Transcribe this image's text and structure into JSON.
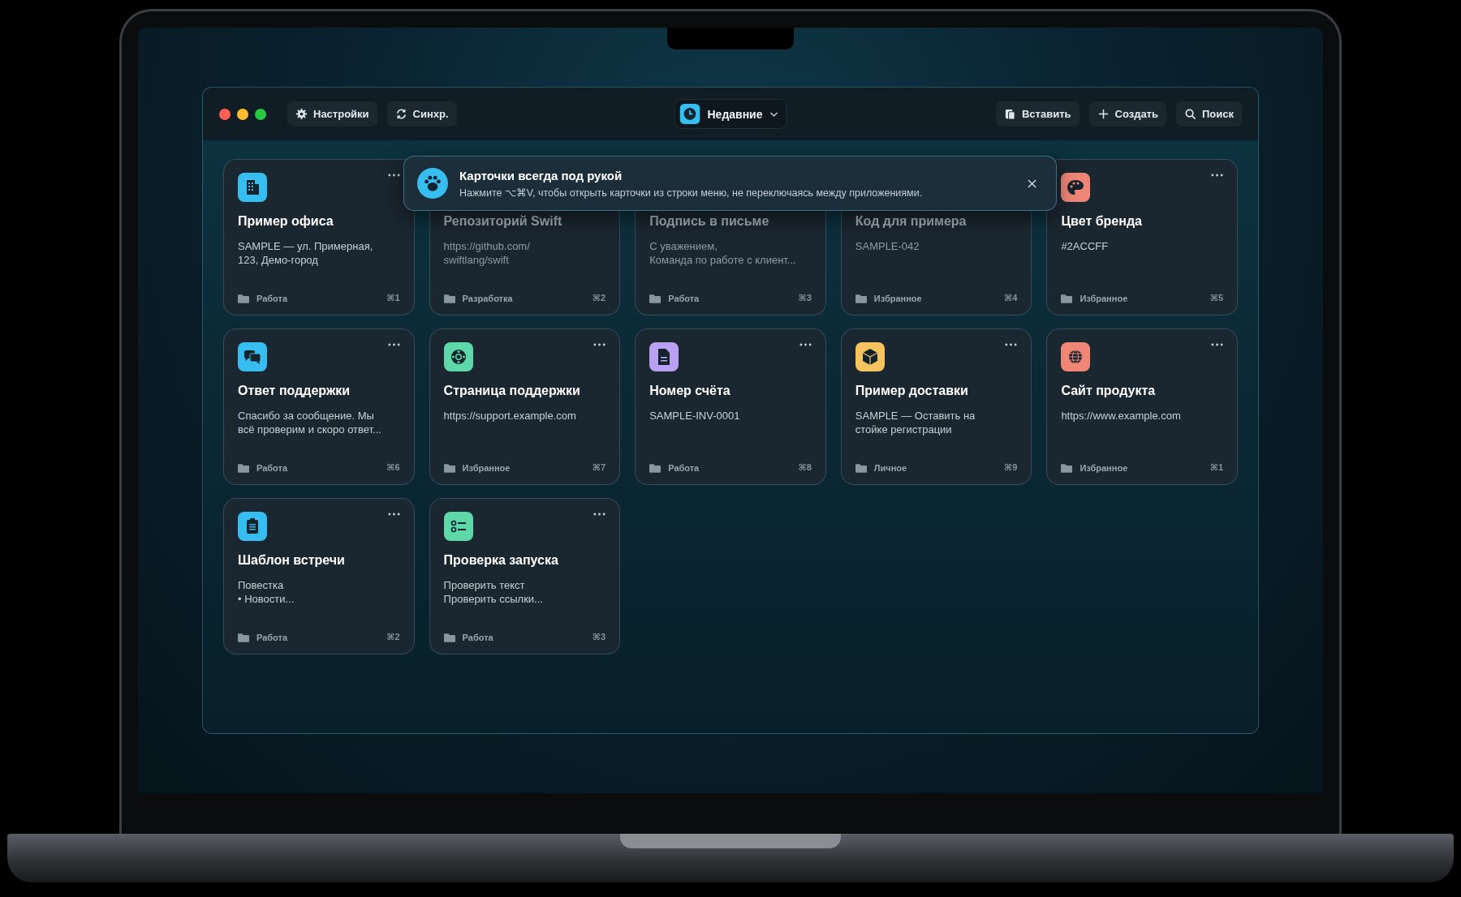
{
  "toolbar": {
    "left_buttons": [
      {
        "kind": "settings",
        "label": "Настройки"
      },
      {
        "kind": "sync",
        "label": "Синхр."
      }
    ],
    "view_switch": {
      "label": "Недавние"
    },
    "right_buttons": [
      {
        "kind": "paste",
        "label": "Вставить"
      },
      {
        "kind": "create",
        "label": "Создать"
      },
      {
        "kind": "search",
        "label": "Поиск"
      }
    ]
  },
  "toast": {
    "title": "Карточки всегда под рукой",
    "text": "Нажмите ⌥⌘V, чтобы открыть карточки из строки меню, не переключаясь между приложениями."
  },
  "cards": [
    {
      "title": "Пример офиса",
      "text": "SAMPLE — ул. Примерная,\n123, Демо-город",
      "folder": "Работа",
      "shortcut": "⌘1",
      "kind": "building",
      "color": "#38bdf0",
      "dimmed": false
    },
    {
      "title": "Репозиторий Swift",
      "text": "https://github.com/\nswiftlang/swift",
      "folder": "Разработка",
      "shortcut": "⌘2",
      "dimmed": true
    },
    {
      "title": "Подпись в письме",
      "text": "С уважением,\nКоманда по работе с клиент...",
      "folder": "Работа",
      "shortcut": "⌘3",
      "dimmed": true
    },
    {
      "title": "Код для примера",
      "text": "SAMPLE-042",
      "folder": "Избранное",
      "shortcut": "⌘4",
      "dimmed": true
    },
    {
      "title": "Цвет бренда",
      "text": "#2ACCFF",
      "folder": "Избранное",
      "shortcut": "⌘5",
      "kind": "palette",
      "color": "#ef8676",
      "dimmed": false
    },
    {
      "title": "Ответ поддержки",
      "text": "Спасибо за сообщение. Мы\nвсё проверим и скоро ответ...",
      "folder": "Работа",
      "shortcut": "⌘6",
      "kind": "chat",
      "color": "#38bdf0",
      "dimmed": false
    },
    {
      "title": "Страница поддержки",
      "text": "https://support.example.com",
      "folder": "Избранное",
      "shortcut": "⌘7",
      "kind": "lifebuoy",
      "color": "#5ed8a8",
      "dimmed": false
    },
    {
      "title": "Номер счёта",
      "text": "SAMPLE-INV-0001",
      "folder": "Работа",
      "shortcut": "⌘8",
      "kind": "document",
      "color": "#b9a0f2",
      "dimmed": false
    },
    {
      "title": "Пример доставки",
      "text": "SAMPLE — Оставить на\nстойке регистрации",
      "folder": "Личное",
      "shortcut": "⌘9",
      "kind": "box",
      "color": "#f5c45e",
      "dimmed": false
    },
    {
      "title": "Сайт продукта",
      "text": "https://www.example.com",
      "folder": "Избранное",
      "shortcut": "⌘1",
      "kind": "globe",
      "color": "#ef8676",
      "dimmed": false
    },
    {
      "title": "Шаблон встречи",
      "text": "Повестка\n• Новости...",
      "folder": "Работа",
      "shortcut": "⌘2",
      "kind": "clipboard",
      "color": "#38bdf0",
      "dimmed": false
    },
    {
      "title": "Проверка запуска",
      "text": "Проверить текст\nПроверить ссылки...",
      "folder": "Работа",
      "shortcut": "⌘3",
      "kind": "checklist",
      "color": "#5ed8a8",
      "dimmed": false
    }
  ]
}
